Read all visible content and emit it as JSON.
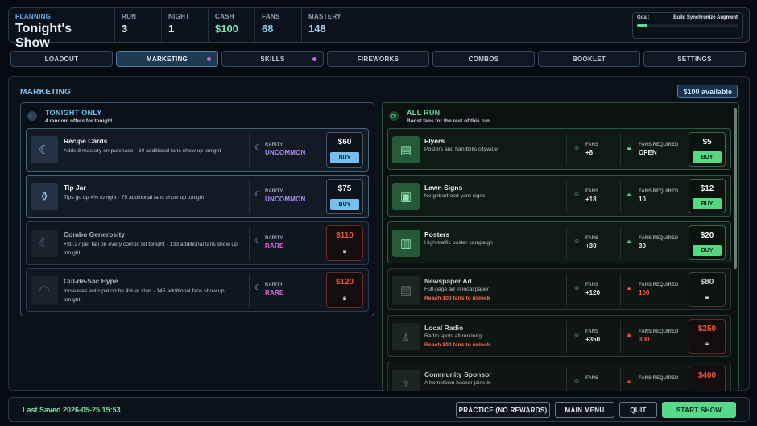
{
  "topbar": {
    "phase_label": "PLANNING",
    "title": "Tonight's Show",
    "stats": [
      {
        "label": "RUN",
        "value": "3"
      },
      {
        "label": "NIGHT",
        "value": "1"
      },
      {
        "label": "CASH",
        "value": "$100"
      },
      {
        "label": "FANS",
        "value": "68"
      },
      {
        "label": "MASTERY",
        "value": "148"
      }
    ],
    "goal": {
      "label": "Goal:",
      "text": "Build Synchronize Augment",
      "progress": 0.1
    }
  },
  "tabs": [
    {
      "label": "LOADOUT"
    },
    {
      "label": "MARKETING"
    },
    {
      "label": "SKILLS"
    },
    {
      "label": "FIREWORKS"
    },
    {
      "label": "COMBOS"
    },
    {
      "label": "BOOKLET"
    },
    {
      "label": "SETTINGS"
    }
  ],
  "main": {
    "title": "MARKETING",
    "available": "$100 available",
    "tonight": {
      "title": "TONIGHT ONLY",
      "subtitle": "4 random offers for tonight",
      "offers": [
        {
          "name": "Recipe Cards",
          "desc": "Adds 8 mastery on purchase · 60 additional fans show up tonight",
          "rarity_label": "RARITY",
          "rarity": "UNCOMMON",
          "price": "$60",
          "buy": "BUY"
        },
        {
          "name": "Tip Jar",
          "desc": "Tips go up 4% tonight · 75 additional fans show up tonight",
          "rarity_label": "RARITY",
          "rarity": "UNCOMMON",
          "price": "$75",
          "buy": "BUY"
        },
        {
          "name": "Combo Generosity",
          "desc": "+$0.27 per fan on every combo hit tonight · 133 additional fans show up tonight",
          "rarity_label": "RARITY",
          "rarity": "RARE",
          "price": "$110"
        },
        {
          "name": "Cul-de-Sac Hype",
          "desc": "Increases anticipation by 4% at start · 145 additional fans show up tonight",
          "rarity_label": "RARITY",
          "rarity": "RARE",
          "price": "$120"
        }
      ]
    },
    "allrun": {
      "title": "ALL RUN",
      "subtitle": "Boost fans for the rest of this run",
      "items": [
        {
          "name": "Flyers",
          "desc": "Posters and handbills citywide",
          "fans_label": "FANS",
          "fans": "+8",
          "req_label": "FANS REQUIRED",
          "req": "OPEN",
          "price": "$5",
          "buy": "BUY"
        },
        {
          "name": "Lawn Signs",
          "desc": "Neighborhood yard signs",
          "fans_label": "FANS",
          "fans": "+18",
          "req_label": "FANS REQUIRED",
          "req": "10",
          "price": "$12",
          "buy": "BUY"
        },
        {
          "name": "Posters",
          "desc": "High-traffic poster campaign",
          "fans_label": "FANS",
          "fans": "+30",
          "req_label": "FANS REQUIRED",
          "req": "30",
          "price": "$20",
          "buy": "BUY"
        },
        {
          "name": "Newspaper Ad",
          "desc": "Full-page ad in local paper",
          "unlock": "Reach 100 fans to unlock",
          "fans_label": "FANS",
          "fans": "+120",
          "req_label": "FANS REQUIRED",
          "req": "100",
          "price": "$80"
        },
        {
          "name": "Local Radio",
          "desc": "Radio spots all run long",
          "unlock": "Reach 300 fans to unlock",
          "fans_label": "FANS",
          "fans": "+350",
          "req_label": "FANS REQUIRED",
          "req": "300",
          "price": "$250"
        },
        {
          "name": "Community Sponsor",
          "desc": "A hometown backer joins in",
          "fans_label": "FANS",
          "fans": "",
          "req_label": "FANS REQUIRED",
          "req": "",
          "price": "$400"
        }
      ]
    }
  },
  "footer": {
    "last_saved": "Last Saved 2026-05-25 15:53",
    "practice": "PRACTICE (NO REWARDS)",
    "main_menu": "MAIN MENU",
    "quit": "QUIT",
    "start": "START SHOW"
  }
}
